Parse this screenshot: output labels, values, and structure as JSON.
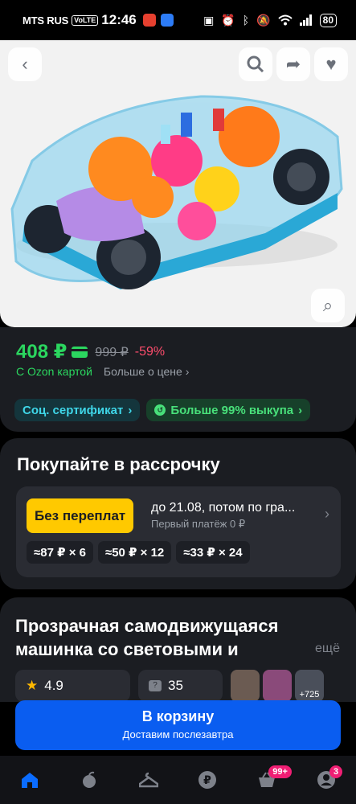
{
  "status_bar": {
    "carrier": "MTS RUS",
    "volte": "VoLTE",
    "time": "12:46",
    "battery": "80",
    "icons": [
      "nfc-icon",
      "alarm-icon",
      "bluetooth-icon",
      "mute-icon",
      "wifi-icon",
      "signal-icon"
    ]
  },
  "product_image": {
    "back_icon": "chevron-left-icon",
    "search_icon": "search-icon",
    "share_icon": "share-icon",
    "favorite_icon": "heart-icon",
    "similar_icon": "image-search-icon"
  },
  "price": {
    "current": "408 ₽",
    "old": "999 ₽",
    "discount": "-59%",
    "ozon_card": "С Ozon картой",
    "more_about_price": "Больше о цене",
    "colors": {
      "price": "#2bd65f",
      "discount": "#ff4d6d"
    }
  },
  "chips": {
    "certificate": "Соц. сертификат",
    "buyout": "Больше 99% выкупа"
  },
  "installment": {
    "title": "Покупайте в рассрочку",
    "badge": "Без переплат",
    "text": "до 21.08, потом по гра...",
    "first_payment": "Первый платёж 0 ₽",
    "plans": [
      "≈87 ₽ × 6",
      "≈50 ₽ × 12",
      "≈33 ₽ × 24"
    ]
  },
  "product": {
    "title_line1": "Прозрачная самодвижущаяся",
    "title_line2": "машинка со световыми и",
    "more": "ещё",
    "rating": "4.9",
    "questions": "35",
    "thumb_text": "+725"
  },
  "cart": {
    "label": "В корзину",
    "delivery": "Доставим послезавтра",
    "color": "#0a5df0"
  },
  "nav": {
    "items": [
      "home-icon",
      "fresh-icon",
      "clothes-icon",
      "finance-icon",
      "cart-icon",
      "profile-icon"
    ],
    "cart_badge": "99+",
    "profile_badge": "3"
  }
}
